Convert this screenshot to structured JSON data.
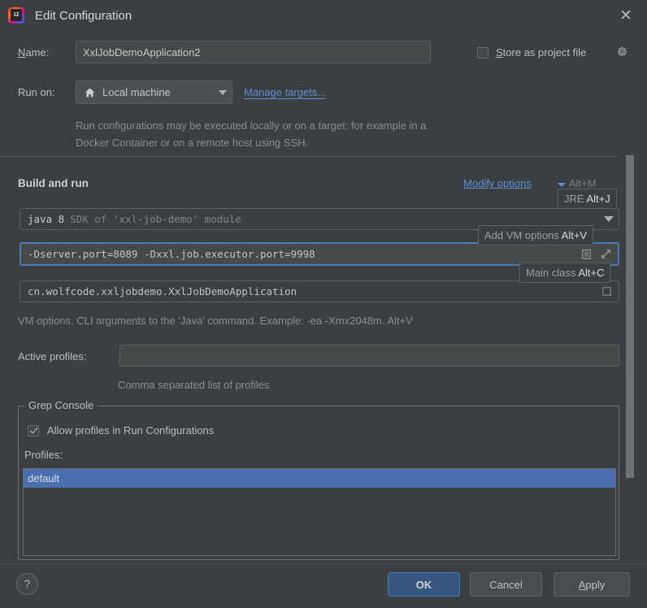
{
  "window": {
    "title": "Edit Configuration",
    "app_icon": "intellij-idea-icon",
    "close_icon": "✕"
  },
  "name_row": {
    "label": "Name:",
    "value": "XxlJobDemoApplication2",
    "store_as_project_file": {
      "label": "Store as project file",
      "checked": false
    },
    "gear_icon": "gear-icon"
  },
  "run_on": {
    "label": "Run on:",
    "selected": "Local machine",
    "icon": "home-icon",
    "manage_targets_link": "Manage targets...",
    "description": "Run configurations may be executed locally or on a target: for example in a Docker Container or on a remote host using SSH."
  },
  "build_and_run": {
    "section_title": "Build and run",
    "modify_options_link": "Modify options",
    "modify_options_underlined_char": "M",
    "modify_options_rest": "odify options",
    "modify_options_shortcut": "Alt+M",
    "jre": {
      "primary": "java 8",
      "secondary": "SDK of 'xxl-job-demo' module"
    },
    "vm_options": {
      "value": "-Dserver.port=8089  -Dxxl.job.executor.port=9998",
      "expand_icon": "expand-icon",
      "document_icon": "document-icon"
    },
    "main_class": {
      "value": "cn.wolfcode.xxljobdemo.XxlJobDemoApplication",
      "browse_icon": "browse-icon"
    },
    "vm_hint": "VM options. CLI arguments to the 'Java' command. Example: -ea -Xmx2048m. Alt+V"
  },
  "tooltips": [
    {
      "text": "JRE ",
      "shortcut": "Alt+J"
    },
    {
      "text": "Add VM options ",
      "shortcut": "Alt+V"
    },
    {
      "text": "Main class ",
      "shortcut": "Alt+C"
    }
  ],
  "active_profiles": {
    "label": "Active profiles:",
    "value": "",
    "placeholder": "",
    "hint": "Comma separated list of profiles"
  },
  "grep_console": {
    "group_title": "Grep Console",
    "allow_profiles": {
      "label": "Allow profiles in Run Configurations",
      "checked": true
    },
    "profiles_label": "Profiles:",
    "profiles": [
      {
        "name": "default",
        "selected": true
      }
    ]
  },
  "footer": {
    "help_label": "?",
    "ok_label": "OK",
    "cancel_label": "Cancel",
    "apply_label": "Apply"
  },
  "colors": {
    "background": "#3c3f41",
    "accent_link": "#5d90d3",
    "selection": "#4b6eaf",
    "focus_border": "#4a7ab0",
    "ok_button": "#365880"
  }
}
